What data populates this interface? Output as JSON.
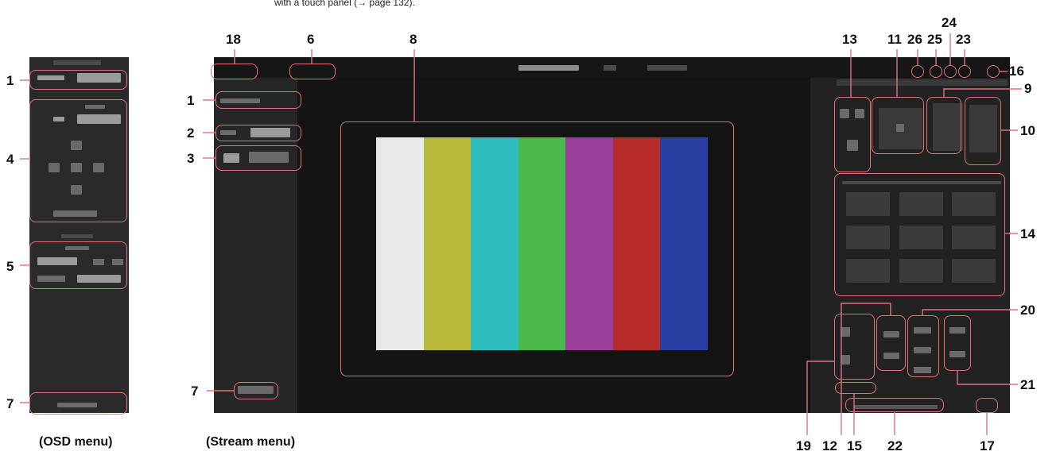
{
  "header_note": "with a touch panel (→ page 132).",
  "captions": {
    "osd": "(OSD menu)",
    "stream": "(Stream menu)"
  },
  "osd_callouts": {
    "c1": "1",
    "c4": "4",
    "c5": "5",
    "c7": "7"
  },
  "stream_callouts": {
    "c18": "18",
    "c6": "6",
    "c8": "8",
    "c1": "1",
    "c2": "2",
    "c3": "3",
    "c7": "7",
    "c13": "13",
    "c11": "11",
    "c26": "26",
    "c25": "25",
    "c24": "24",
    "c23": "23",
    "c16": "16",
    "c9": "9",
    "c10": "10",
    "c14": "14",
    "c20": "20",
    "c21": "21",
    "c19": "19",
    "c12": "12",
    "c15": "15",
    "c22": "22",
    "c17": "17"
  },
  "colors": {
    "highlight": "#e0707a",
    "panel": "#222222"
  },
  "color_bars": [
    "#e9e9ea",
    "#b9b93a",
    "#2fbcbc",
    "#4bb84b",
    "#9a3f9a",
    "#b72b2b",
    "#2a3fa2"
  ]
}
